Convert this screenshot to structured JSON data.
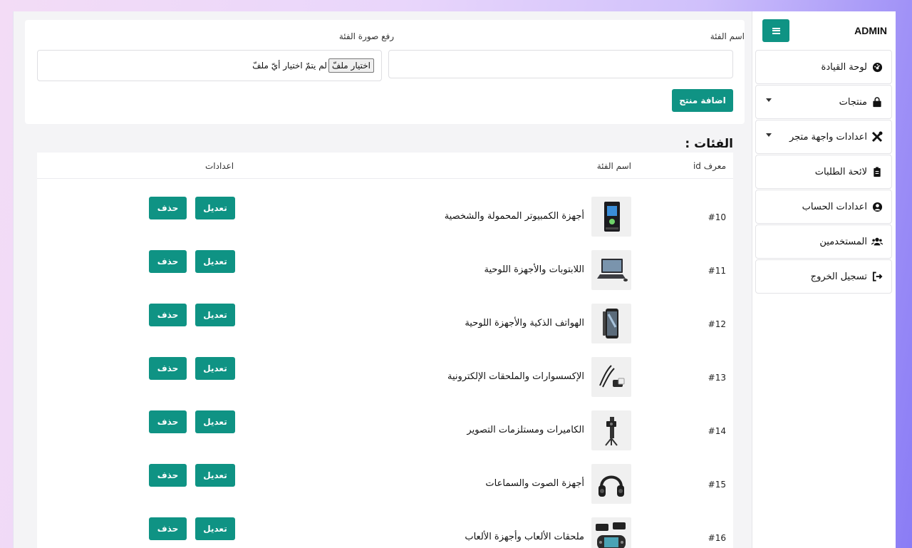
{
  "sidebar": {
    "brand": "ADMIN",
    "items": [
      {
        "label": "لوحة القيادة",
        "icon": "dashboard-icon",
        "caret": false
      },
      {
        "label": "منتجات",
        "icon": "shopping-bag-icon",
        "caret": true
      },
      {
        "label": "اعدادات واجهة متجر",
        "icon": "tools-icon",
        "caret": true
      },
      {
        "label": "لائحة الطلبات",
        "icon": "clipboard-icon",
        "caret": false
      },
      {
        "label": "اعدادات الحساب",
        "icon": "user-circle-icon",
        "caret": false
      },
      {
        "label": "المستخدمين",
        "icon": "users-icon",
        "caret": false
      },
      {
        "label": "تسجيل الخروج",
        "icon": "logout-icon",
        "caret": false
      }
    ]
  },
  "form": {
    "name_label": "اسم الفئة",
    "image_label": "رفع صورة الفئة",
    "file_button": "اختيار ملفّ",
    "file_none": "لم يتمّ اختيار أيّ ملفّ",
    "submit_label": "اضافة منتج"
  },
  "categories": {
    "title": "الفئات :",
    "headers": {
      "id": "معرف id",
      "name": "اسم الفئة",
      "actions": "اعدادات"
    },
    "edit_label": "تعديل",
    "delete_label": "حذف",
    "rows": [
      {
        "id": "#10",
        "name": "أجهزة الكمبيوتر المحمولة والشخصية",
        "thumb": "desktop-pc-icon"
      },
      {
        "id": "#11",
        "name": "اللابتوبات والأجهزة اللوحية",
        "thumb": "laptop-icon"
      },
      {
        "id": "#12",
        "name": "الهواتف الذكية والأجهزة اللوحية",
        "thumb": "smartphone-icon"
      },
      {
        "id": "#13",
        "name": "الإكسسوارات والملحقات الإلكترونية",
        "thumb": "cables-icon"
      },
      {
        "id": "#14",
        "name": "الكاميرات ومستلزمات التصوير",
        "thumb": "camera-gimbal-icon"
      },
      {
        "id": "#15",
        "name": "أجهزة الصوت والسماعات",
        "thumb": "headphones-icon"
      },
      {
        "id": "#16",
        "name": "ملحقات الألعاب وأجهزة الألعاب",
        "thumb": "gaming-console-icon"
      }
    ]
  },
  "colors": {
    "accent": "#0f9384"
  }
}
